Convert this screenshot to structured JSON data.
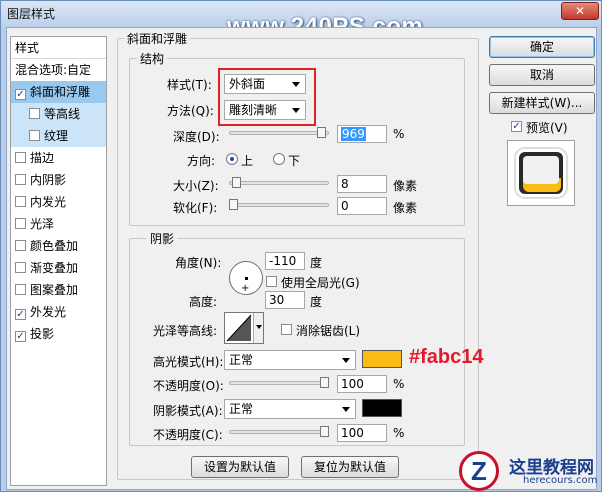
{
  "window": {
    "title": "图层样式",
    "watermark": "www.240PS.com",
    "close_label": "✕"
  },
  "style_list": {
    "header": "样式",
    "blend_options": "混合选项:自定",
    "items": [
      {
        "label": "斜面和浮雕",
        "checked": true,
        "selected": true
      },
      {
        "label": "等高线",
        "checked": false,
        "sub": true
      },
      {
        "label": "纹理",
        "checked": false,
        "sub": true
      },
      {
        "label": "描边",
        "checked": false
      },
      {
        "label": "内阴影",
        "checked": false
      },
      {
        "label": "内发光",
        "checked": false
      },
      {
        "label": "光泽",
        "checked": false
      },
      {
        "label": "颜色叠加",
        "checked": false
      },
      {
        "label": "渐变叠加",
        "checked": false
      },
      {
        "label": "图案叠加",
        "checked": false
      },
      {
        "label": "外发光",
        "checked": true
      },
      {
        "label": "投影",
        "checked": true
      }
    ]
  },
  "bevel": {
    "group_title": "斜面和浮雕",
    "structure_title": "结构",
    "style_label": "样式(T):",
    "style_value": "外斜面",
    "method_label": "方法(Q):",
    "method_value": "雕刻清晰",
    "depth_label": "深度(D):",
    "depth_value": "969",
    "depth_unit": "%",
    "depth_fraction": 0.97,
    "direction_label": "方向:",
    "direction_up": "上",
    "direction_down": "下",
    "size_label": "大小(Z):",
    "size_value": "8",
    "size_unit": "像素",
    "size_fraction": 0.03,
    "soften_label": "软化(F):",
    "soften_value": "0",
    "soften_unit": "像素",
    "soften_fraction": 0.0
  },
  "shading": {
    "group_title": "阴影",
    "angle_label": "角度(N):",
    "angle_value": "-110",
    "angle_unit": "度",
    "global_light_label": "使用全局光(G)",
    "altitude_label": "高度:",
    "altitude_value": "30",
    "altitude_unit": "度",
    "gloss_contour_label": "光泽等高线:",
    "anti_alias_label": "消除锯齿(L)",
    "highlight_mode_label": "高光模式(H):",
    "highlight_mode_value": "正常",
    "highlight_color": "#fabc14",
    "highlight_hex_annotation": "#fabc14",
    "highlight_opacity_label": "不透明度(O):",
    "highlight_opacity_value": "100",
    "highlight_opacity_unit": "%",
    "shadow_mode_label": "阴影模式(A):",
    "shadow_mode_value": "正常",
    "shadow_color": "#000000",
    "shadow_opacity_label": "不透明度(C):",
    "shadow_opacity_value": "100",
    "shadow_opacity_unit": "%"
  },
  "buttons": {
    "make_default": "设置为默认值",
    "reset_default": "复位为默认值",
    "ok": "确定",
    "cancel": "取消",
    "new_style": "新建样式(W)...",
    "preview_label": "预览(V)"
  },
  "logo": {
    "letter": "Z",
    "cn": "这里教程网",
    "en": "herecours.com"
  }
}
